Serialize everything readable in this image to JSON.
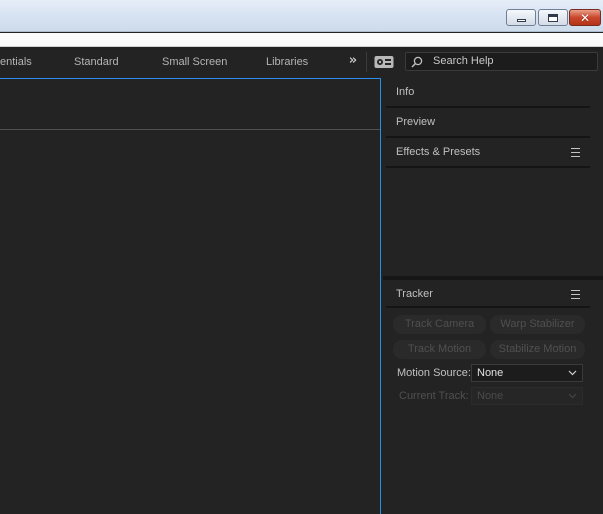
{
  "window": {
    "controls": {
      "minimize_icon": "minimize-icon",
      "maximize_icon": "maximize-icon",
      "close_icon": "close-icon",
      "close_glyph": "✕"
    }
  },
  "workspaces": {
    "items": [
      "entials",
      "Standard",
      "Small Screen",
      "Libraries"
    ],
    "overflow": "»"
  },
  "search": {
    "placeholder": "Search Help"
  },
  "panels": {
    "info": "Info",
    "preview": "Preview",
    "effects": "Effects & Presets",
    "tracker": "Tracker"
  },
  "tracker": {
    "buttons": [
      "Track Camera",
      "Warp Stabilizer",
      "Track Motion",
      "Stabilize Motion"
    ],
    "motion_source_label": "Motion Source:",
    "motion_source_value": "None",
    "current_track_label": "Current Track:",
    "current_track_value": "None"
  },
  "colors": {
    "panel_bg": "#232323",
    "accent": "#2d8ceb",
    "disabled_text": "#505050"
  }
}
